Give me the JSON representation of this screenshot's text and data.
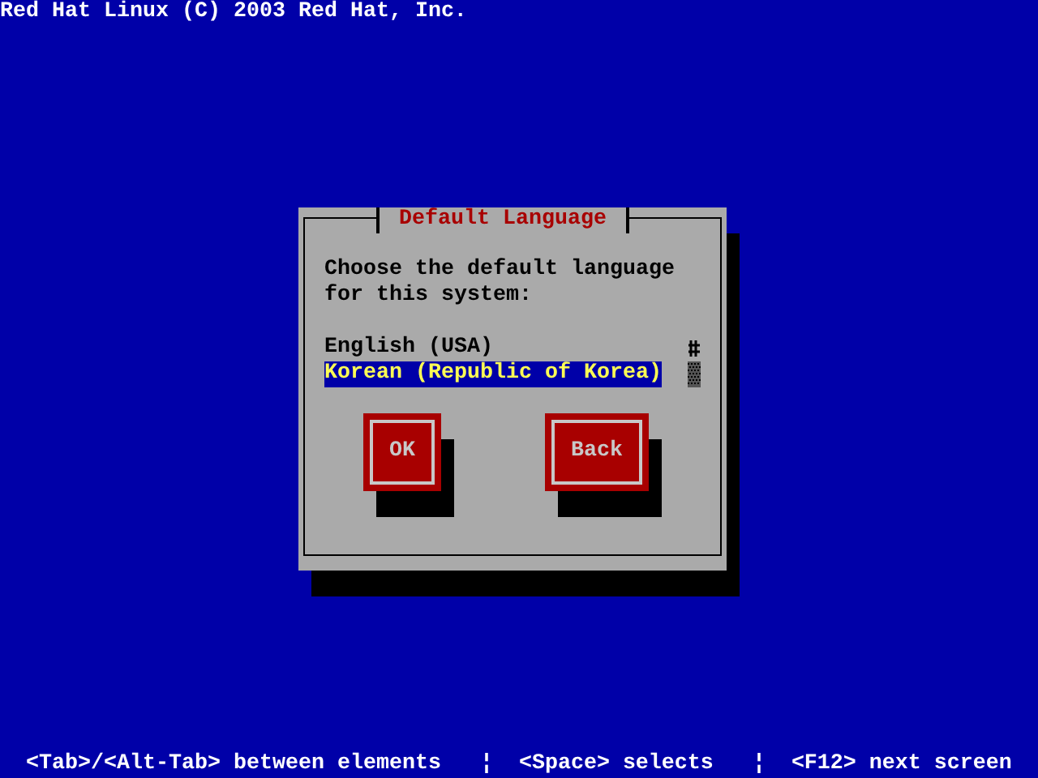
{
  "header": {
    "title": "Red Hat Linux (C) 2003 Red Hat, Inc."
  },
  "dialog": {
    "title": "Default Language",
    "prompt": "Choose the default language for this system:",
    "languages": [
      {
        "label": "English (USA)",
        "selected": false
      },
      {
        "label": "Korean (Republic of Korea)",
        "selected": true
      }
    ],
    "buttons": [
      {
        "label": "OK"
      },
      {
        "label": "Back"
      }
    ]
  },
  "status_bar": [
    {
      "kind": "hint",
      "text": "<Tab>/<Alt-Tab> between elements"
    },
    {
      "kind": "separator",
      "text": "¦"
    },
    {
      "kind": "hint",
      "text": "<Space> selects"
    },
    {
      "kind": "separator",
      "text": "¦"
    },
    {
      "kind": "hint",
      "text": "<F12> next screen"
    }
  ]
}
